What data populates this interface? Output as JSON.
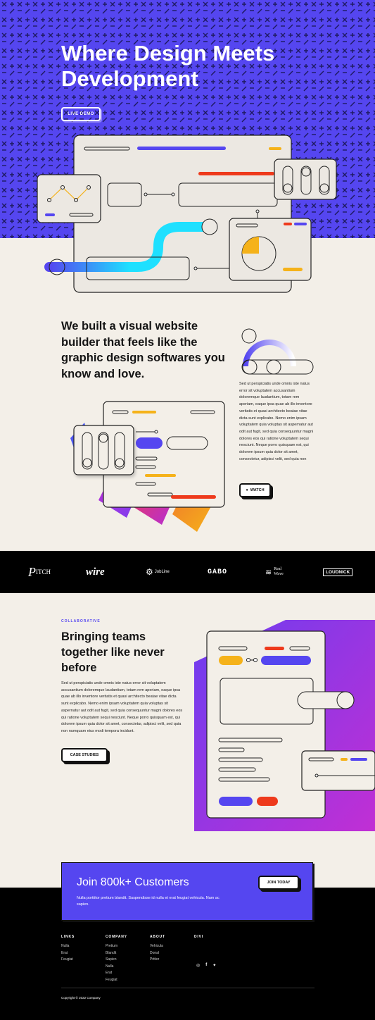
{
  "hero": {
    "title": "Where Design Meets Development",
    "button": "LIVE DEMO"
  },
  "intro": {
    "heading": "We built a visual website builder that feels like the graphic design softwares you know and love.",
    "body": "Sed ut perspiciatis unde omnis iste natus error sit voluptatem accusantium doloremque laudantium, totam rem aperiam, eaque ipsa quae ab illo inventore veritatis et quasi architecto beatae vitae dicta sunt explicabo. Nemo enim ipsam voluptatem quia voluptas sit aspernatur aut odit aut fugit, sed quia consequuntur magni dolores eos qui ratione voluptatem sequi nesciunt. Neque porro quisquam est, qui dolorem ipsum quia dolor sit amet, consectetur, adipisci velit, sed quia non",
    "button": "WATCH"
  },
  "logos": [
    "PITCH",
    "wire",
    "JobLine",
    "GABO",
    "Real Wave",
    "LOUDNICK"
  ],
  "collab": {
    "eyebrow": "COLLABORATIVE",
    "heading": "Bringing teams together like never before",
    "body": "Sed ut perspiciatis unde omnis iste natus error sit voluptatem accusantium doloremque laudantium, totam rem aperiam, eaque ipsa quae ab illo inventore veritatis et quasi architecto beatae vitae dicta sunt explicabo. Nemo enim ipsam voluptatem quia voluptas sit aspernatur aut odit aut fugit, sed quia consequuntur magni dolores eos qui ratione voluptatem sequi nesciunt. Neque porro quisquam est, qui dolorem ipsum quia dolor sit amet, consectetur, adipisci velit, sed quia non numquam eius modi tempora incidunt.",
    "button": "CASE STUDIES"
  },
  "cta": {
    "title": "Join 800k+ Customers",
    "text": "Nulla porttitor pretium blandit. Suspendisse id nulla et erat feugiat vehicula. Nam ac sapien.",
    "button": "JOIN TODAY"
  },
  "footer": {
    "columns": [
      {
        "title": "LINKS",
        "items": [
          "Nulla",
          "Erat",
          "Feugiat"
        ]
      },
      {
        "title": "COMPANY",
        "items": [
          "Pretium",
          "Blandit",
          "Sapien",
          "Nulla",
          "Erat",
          "Feugiat"
        ]
      },
      {
        "title": "ABOUT",
        "items": [
          "Vehicula",
          "Donal",
          "Prttior"
        ]
      },
      {
        "title": "DIVI",
        "items": []
      }
    ],
    "social_icons": [
      "instagram-icon",
      "facebook-icon",
      "twitter-icon"
    ],
    "copyright": "Copyright © 2022 Company"
  },
  "colors": {
    "accent": "#5546f0",
    "yellow": "#f5b21a",
    "red": "#ee3a1c",
    "cyan": "#1fe0ff",
    "cream": "#f3efe8",
    "dark": "#000000"
  }
}
